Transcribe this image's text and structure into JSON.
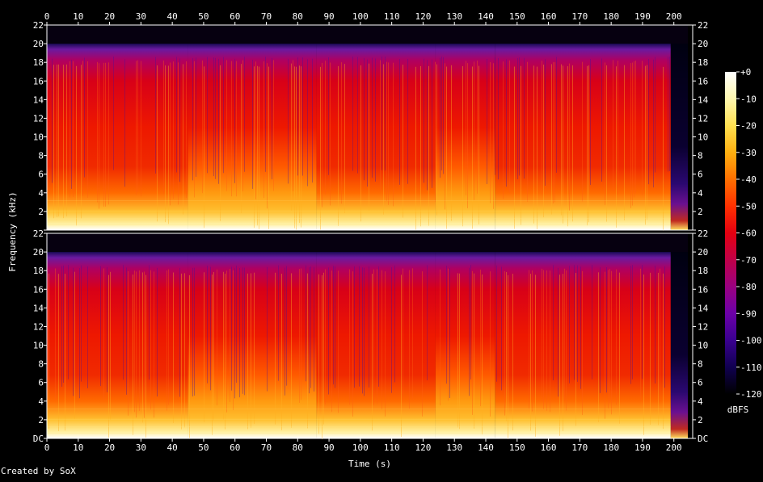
{
  "chart_data": {
    "type": "heatmap",
    "xlabel": "Time (s)",
    "ylabel": "Frequency (kHz)",
    "xlim": [
      0,
      206
    ],
    "ylim": [
      0,
      22
    ],
    "x_ticks": [
      "0",
      "10",
      "20",
      "30",
      "40",
      "50",
      "60",
      "70",
      "80",
      "90",
      "100",
      "110",
      "120",
      "130",
      "140",
      "150",
      "160",
      "170",
      "180",
      "190",
      "200"
    ],
    "channels": [
      {
        "y_ticks_left": [
          "DC",
          "2",
          "4",
          "6",
          "8",
          "10",
          "12",
          "14",
          "16",
          "18",
          "20",
          "22"
        ],
        "y_ticks_right": [
          "DC",
          "2",
          "4",
          "6",
          "8",
          "10",
          "12",
          "14",
          "16",
          "18",
          "20",
          "22"
        ]
      },
      {
        "y_ticks_left": [
          "DC",
          "2",
          "4",
          "6",
          "8",
          "10",
          "12",
          "14",
          "16",
          "18",
          "20",
          "22"
        ],
        "y_ticks_right": [
          "DC",
          "2",
          "4",
          "6",
          "8",
          "10",
          "12",
          "14",
          "16",
          "18",
          "20",
          "22"
        ]
      }
    ],
    "colorbar": {
      "unit": "dBFS",
      "ticks": [
        "+0",
        "-10",
        "-20",
        "-30",
        "-40",
        "-50",
        "-60",
        "-70",
        "-80",
        "-90",
        "-100",
        "-110",
        "-120"
      ],
      "colors": [
        "#ffffff",
        "#fff8b0",
        "#ffe050",
        "#ffb010",
        "#ff7000",
        "#ff3000",
        "#e40010",
        "#c00048",
        "#9a0080",
        "#6c00a8",
        "#3a0090",
        "#100050",
        "#000000"
      ]
    },
    "cutoff_khz": 20,
    "audio_end_s": 199,
    "segments": [
      {
        "start_s": 0,
        "end_s": 45,
        "intensity": 0.55
      },
      {
        "start_s": 45,
        "end_s": 86,
        "intensity": 0.8
      },
      {
        "start_s": 86,
        "end_s": 124,
        "intensity": 0.58
      },
      {
        "start_s": 124,
        "end_s": 143,
        "intensity": 0.72
      },
      {
        "start_s": 143,
        "end_s": 199,
        "intensity": 0.62
      }
    ]
  },
  "footer": {
    "credit": "Created by SoX"
  }
}
